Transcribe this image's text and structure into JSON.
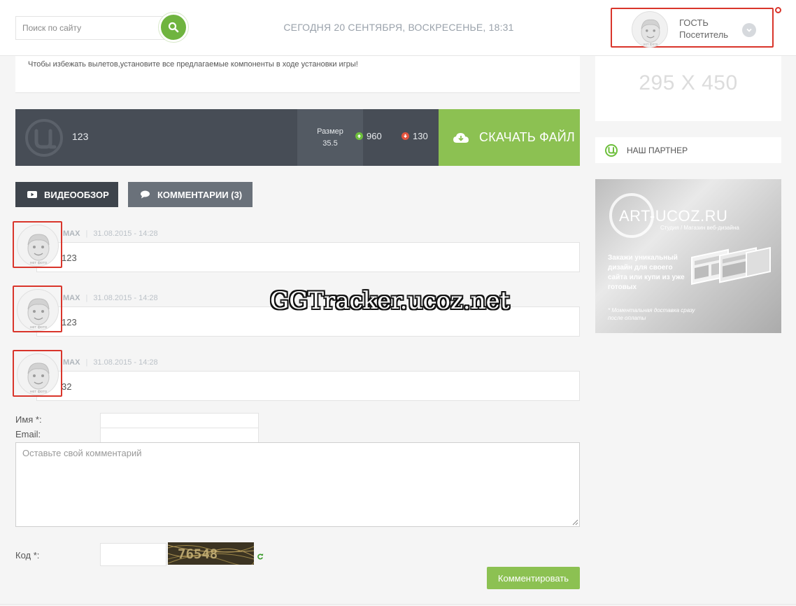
{
  "header": {
    "search_placeholder": "Поиск по сайту",
    "date_line": "СЕГОДНЯ 20 СЕНТЯБРЯ, ВОСКРЕСЕНЬЕ, 18:31",
    "user": {
      "name": "ГОСТЬ",
      "group": "Посетитель",
      "avatar_caption": "нет фото"
    }
  },
  "notice": {
    "text": "Чтобы избежать вылетов,установите все предлагаемые компоненты в ходе установки игры!"
  },
  "download": {
    "name": "123",
    "size_label": "Размер",
    "size_value": "35.5",
    "seeders": "960",
    "leechers": "130",
    "button_label": "СКАЧАТЬ ФАЙЛ"
  },
  "tabs": {
    "video": "ВИДЕООБЗОР",
    "comments": "КОММЕНТАРИИ (3)"
  },
  "comments": [
    {
      "author": "MAX",
      "date": "31.08.2015 - 14:28",
      "text": "123",
      "avatar_caption": "нет фото"
    },
    {
      "author": "MAX",
      "date": "31.08.2015 - 14:28",
      "text": "123",
      "avatar_caption": "нет фото"
    },
    {
      "author": "MAX",
      "date": "31.08.2015 - 14:28",
      "text": "32",
      "avatar_caption": "нет фото"
    }
  ],
  "watermark": "GGTracker.ucoz.net",
  "form": {
    "name_label": "Имя *:",
    "email_label": "Email:",
    "comment_placeholder": "Оставьте свой комментарий",
    "code_label": "Код *:",
    "captcha_text": "76548",
    "submit_label": "Комментировать"
  },
  "sidebar": {
    "ad_placeholder": "295 X 450",
    "partner_label": "НАШ ПАРТНЕР",
    "banner": {
      "logo": "ART-UCOZ.RU",
      "subtitle": "Студия / Магазин веб-дизайна",
      "promo": "Закажи уникальный дизайн для своего сайта или купи из уже готовых",
      "note": "* Моментальная доставка сразу после оплаты"
    }
  },
  "colors": {
    "accent_green": "#8cc152",
    "dark_bar": "#474d56",
    "highlight_red": "#d9352b"
  }
}
